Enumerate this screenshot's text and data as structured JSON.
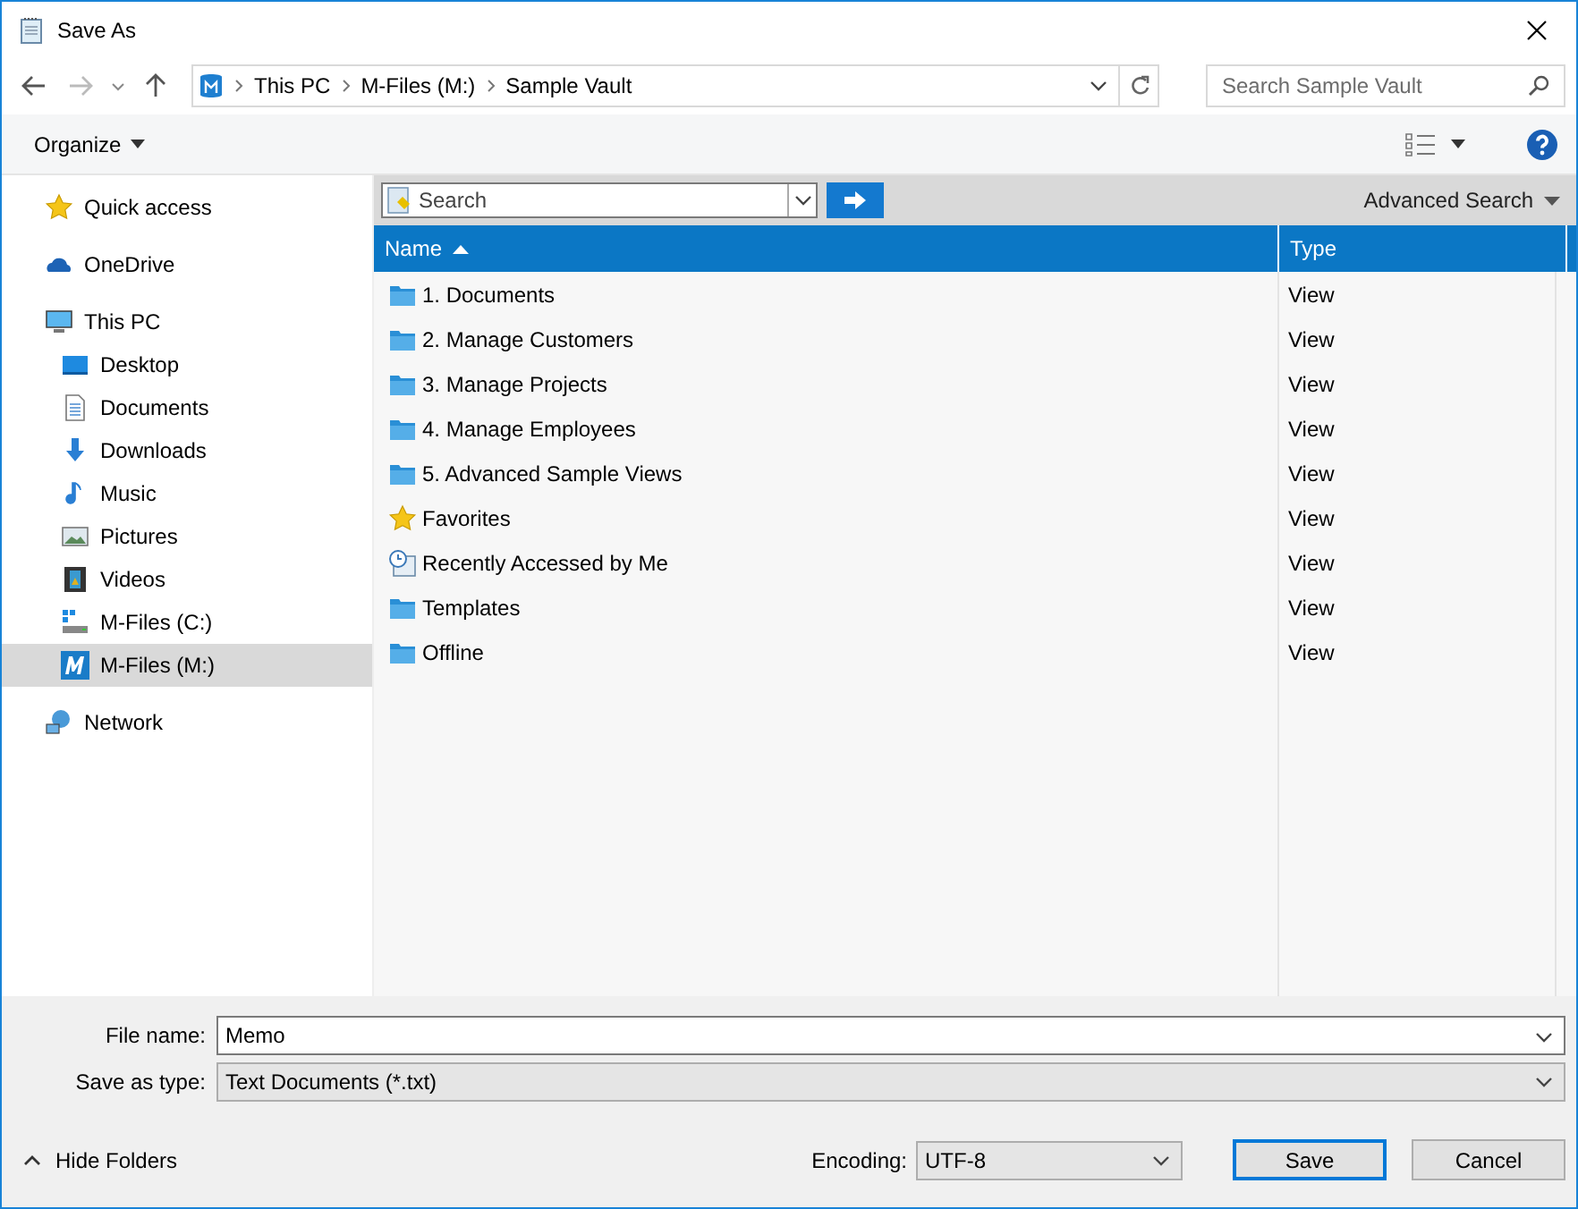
{
  "window": {
    "title": "Save As"
  },
  "address_bar": {
    "path": [
      "This PC",
      "M-Files (M:)",
      "Sample Vault"
    ]
  },
  "search_box": {
    "placeholder": "Search Sample Vault"
  },
  "toolbar": {
    "organize": "Organize"
  },
  "sidebar": {
    "items": [
      {
        "label": "Quick access",
        "kind": "star",
        "selected": false
      },
      {
        "label": "OneDrive",
        "kind": "cloud",
        "selected": false
      },
      {
        "label": "This PC",
        "kind": "monitor",
        "selected": false,
        "children": [
          {
            "label": "Desktop",
            "kind": "desktop",
            "selected": false
          },
          {
            "label": "Documents",
            "kind": "document",
            "selected": false
          },
          {
            "label": "Downloads",
            "kind": "download",
            "selected": false
          },
          {
            "label": "Music",
            "kind": "music",
            "selected": false
          },
          {
            "label": "Pictures",
            "kind": "pictures",
            "selected": false
          },
          {
            "label": "Videos",
            "kind": "film",
            "selected": false
          },
          {
            "label": "M-Files (C:)",
            "kind": "drive",
            "selected": false
          },
          {
            "label": "M-Files (M:)",
            "kind": "mfiles",
            "selected": true
          }
        ]
      },
      {
        "label": "Network",
        "kind": "network",
        "selected": false
      }
    ]
  },
  "vault_search": {
    "placeholder": "Search",
    "advanced": "Advanced Search"
  },
  "table": {
    "columns": [
      "Name",
      "Type"
    ],
    "rows": [
      {
        "name": "1. Documents",
        "type": "View",
        "kind": "folder"
      },
      {
        "name": "2. Manage Customers",
        "type": "View",
        "kind": "folder"
      },
      {
        "name": "3. Manage Projects",
        "type": "View",
        "kind": "folder"
      },
      {
        "name": "4. Manage Employees",
        "type": "View",
        "kind": "folder"
      },
      {
        "name": "5. Advanced Sample Views",
        "type": "View",
        "kind": "folder"
      },
      {
        "name": "Favorites",
        "type": "View",
        "kind": "star"
      },
      {
        "name": "Recently Accessed by Me",
        "type": "View",
        "kind": "recent"
      },
      {
        "name": "Templates",
        "type": "View",
        "kind": "folder"
      },
      {
        "name": "Offline",
        "type": "View",
        "kind": "folder"
      }
    ]
  },
  "form": {
    "file_name_label": "File name:",
    "file_name": "Memo",
    "type_label": "Save as type:",
    "type_value": "Text Documents (*.txt)",
    "encoding_label": "Encoding:",
    "encoding": "UTF-8"
  },
  "hide_folders": "Hide Folders",
  "buttons": [
    "Save",
    "Cancel"
  ]
}
